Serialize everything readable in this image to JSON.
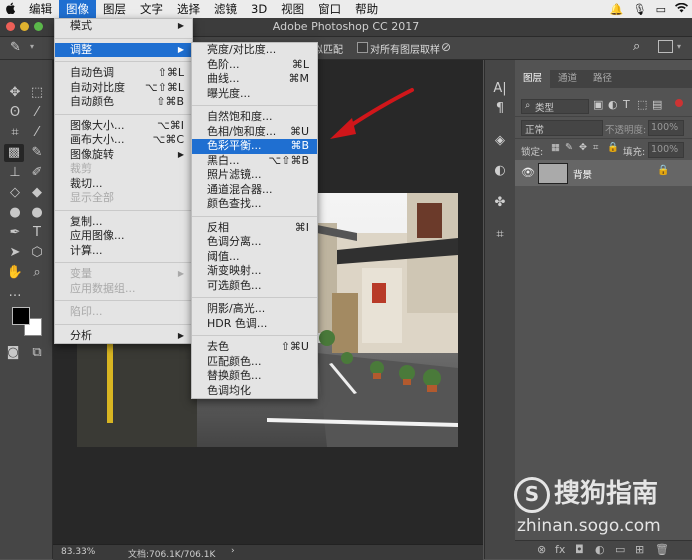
{
  "menubar": {
    "items": [
      "编辑",
      "图像",
      "图层",
      "文字",
      "选择",
      "滤镜",
      "3D",
      "视图",
      "窗口",
      "帮助"
    ],
    "active": "图像"
  },
  "titlebar": {
    "title": "Adobe Photoshop CC 2017"
  },
  "optbar": {
    "sample_all_layers_label": "对所有图层取样",
    "auto_match_label": "似匹配"
  },
  "image_menu": [
    {
      "label": "模式",
      "shortcut": "",
      "submenu": true
    },
    {
      "sep": true
    },
    {
      "label": "调整",
      "shortcut": "",
      "submenu": true,
      "highlight": true
    },
    {
      "sep": true
    },
    {
      "label": "自动色调",
      "shortcut": "⇧⌘L"
    },
    {
      "label": "自动对比度",
      "shortcut": "⌥⇧⌘L"
    },
    {
      "label": "自动颜色",
      "shortcut": "⇧⌘B"
    },
    {
      "sep": true
    },
    {
      "label": "图像大小...",
      "shortcut": "⌥⌘I"
    },
    {
      "label": "画布大小...",
      "shortcut": "⌥⌘C"
    },
    {
      "label": "图像旋转",
      "shortcut": "",
      "submenu": true
    },
    {
      "label": "裁剪",
      "shortcut": "",
      "disabled": true
    },
    {
      "label": "裁切...",
      "shortcut": ""
    },
    {
      "label": "显示全部",
      "shortcut": "",
      "disabled": true
    },
    {
      "sep": true
    },
    {
      "label": "复制...",
      "shortcut": ""
    },
    {
      "label": "应用图像...",
      "shortcut": ""
    },
    {
      "label": "计算...",
      "shortcut": ""
    },
    {
      "sep": true
    },
    {
      "label": "变量",
      "shortcut": "",
      "submenu": true,
      "disabled": true
    },
    {
      "label": "应用数据组...",
      "shortcut": "",
      "disabled": true
    },
    {
      "sep": true
    },
    {
      "label": "陷印...",
      "shortcut": "",
      "disabled": true
    },
    {
      "sep": true
    },
    {
      "label": "分析",
      "shortcut": "",
      "submenu": true
    }
  ],
  "adjust_menu": [
    {
      "label": "亮度/对比度...",
      "shortcut": ""
    },
    {
      "label": "色阶...",
      "shortcut": "⌘L"
    },
    {
      "label": "曲线...",
      "shortcut": "⌘M"
    },
    {
      "label": "曝光度...",
      "shortcut": ""
    },
    {
      "sep": true
    },
    {
      "label": "自然饱和度...",
      "shortcut": ""
    },
    {
      "label": "色相/饱和度...",
      "shortcut": "⌘U"
    },
    {
      "label": "色彩平衡...",
      "shortcut": "⌘B",
      "highlight": true
    },
    {
      "label": "黑白...",
      "shortcut": "⌥⇧⌘B"
    },
    {
      "label": "照片滤镜...",
      "shortcut": ""
    },
    {
      "label": "通道混合器...",
      "shortcut": ""
    },
    {
      "label": "颜色查找...",
      "shortcut": ""
    },
    {
      "sep": true
    },
    {
      "label": "反相",
      "shortcut": "⌘I"
    },
    {
      "label": "色调分离...",
      "shortcut": ""
    },
    {
      "label": "阈值...",
      "shortcut": ""
    },
    {
      "label": "渐变映射...",
      "shortcut": ""
    },
    {
      "label": "可选颜色...",
      "shortcut": ""
    },
    {
      "sep": true
    },
    {
      "label": "阴影/高光...",
      "shortcut": ""
    },
    {
      "label": "HDR 色调...",
      "shortcut": ""
    },
    {
      "sep": true
    },
    {
      "label": "去色",
      "shortcut": "⇧⌘U"
    },
    {
      "label": "匹配颜色...",
      "shortcut": ""
    },
    {
      "label": "替换颜色...",
      "shortcut": ""
    },
    {
      "label": "色调均化",
      "shortcut": ""
    }
  ],
  "layers_panel": {
    "tabs": [
      "图层",
      "通道",
      "路径"
    ],
    "filter": "类型",
    "blend_mode": "正常",
    "opacity_label": "不透明度:",
    "opacity_value": "100%",
    "lock_label": "锁定:",
    "fill_label": "填充:",
    "fill_value": "100%",
    "layer_name": "背景"
  },
  "status": {
    "zoom": "83.33%",
    "doc": "文档:706.1K/706.1K"
  },
  "watermark": {
    "brand": "搜狗指南",
    "url": "zhinan.sogo.com"
  },
  "colors": {
    "accent": "#1f6fd1",
    "arrow": "#d0161a"
  }
}
